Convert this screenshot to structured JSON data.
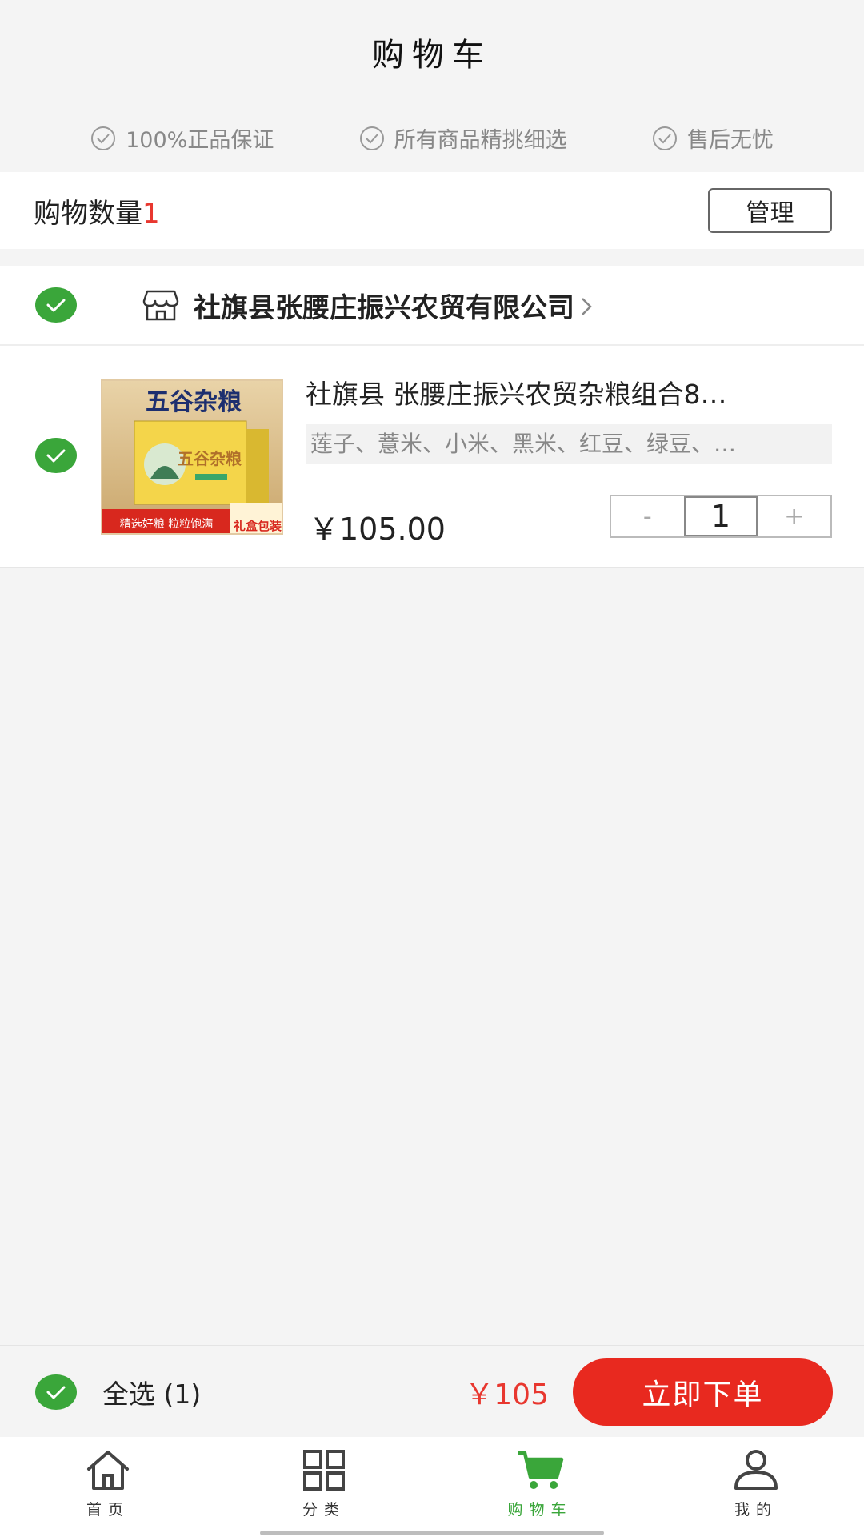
{
  "header": {
    "title": "购物车"
  },
  "guarantees": [
    {
      "icon": "check-circle-icon",
      "label": "100%正品保证"
    },
    {
      "icon": "check-circle-icon",
      "label": "所有商品精挑细选"
    },
    {
      "icon": "check-circle-icon",
      "label": "售后无忧"
    }
  ],
  "count_bar": {
    "label": "购物数量",
    "count": "1",
    "manage_label": "管理"
  },
  "store": {
    "name": "社旗县张腰庄振兴农贸有限公司",
    "icon": "store-icon",
    "checked": true
  },
  "item": {
    "checked": true,
    "title": "社旗县 张腰庄振兴农贸杂粮组合8…",
    "spec": "莲子、薏米、小米、黑米、红豆、绿豆、…",
    "price": "￥105.00",
    "quantity": "1",
    "minus_label": "-",
    "plus_label": "+",
    "image": {
      "banner_text": "五谷杂粮",
      "box_text": "五谷杂粮",
      "slogan": "精选好粮 粒粒饱满",
      "badge": "礼盒包装"
    }
  },
  "checkout": {
    "select_all_label": "全选 (1)",
    "total": "￥105",
    "order_button": "立即下单"
  },
  "tabbar": [
    {
      "icon": "home-icon",
      "label": "首页",
      "active": false
    },
    {
      "icon": "grid-icon",
      "label": "分类",
      "active": false
    },
    {
      "icon": "cart-icon",
      "label": "购物车",
      "active": true
    },
    {
      "icon": "user-icon",
      "label": "我的",
      "active": false
    }
  ],
  "colors": {
    "accent_green": "#3aa63a",
    "accent_red": "#e8291f",
    "price_red": "#e8372f"
  }
}
